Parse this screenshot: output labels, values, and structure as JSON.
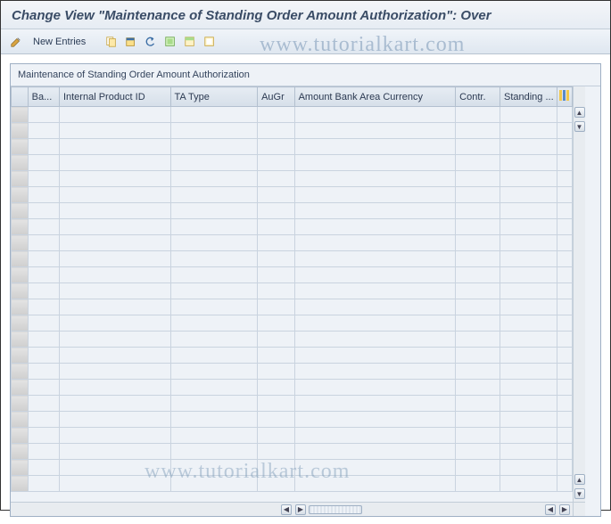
{
  "header": {
    "title": "Change View \"Maintenance of Standing Order Amount Authorization\": Over"
  },
  "toolbar": {
    "new_entries_label": "New Entries"
  },
  "panel": {
    "title": "Maintenance of Standing Order Amount Authorization"
  },
  "columns": {
    "bank_area": "Ba...",
    "internal_product_id": "Internal Product ID",
    "ta_type": "TA Type",
    "augr": "AuGr",
    "amount_bank_area_currency": "Amount Bank Area Currency",
    "contr": "Contr.",
    "standing": "Standing ..."
  },
  "watermark": "www.tutorialkart.com",
  "row_count": 24
}
